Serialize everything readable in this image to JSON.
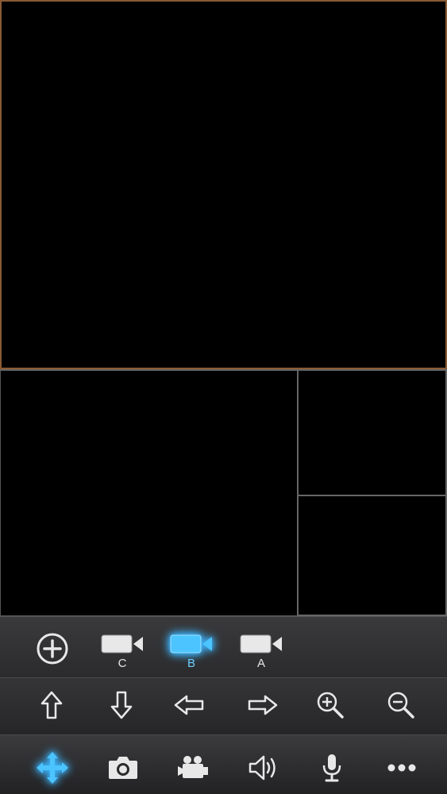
{
  "video_panes": [
    {
      "id": "main",
      "selected": true
    },
    {
      "id": "2",
      "selected": false
    },
    {
      "id": "3",
      "selected": false
    },
    {
      "id": "4",
      "selected": false
    }
  ],
  "stream_row": {
    "add_icon": "plus-circle-icon",
    "streams": [
      {
        "label": "C",
        "icon": "video-camera-icon",
        "active": false
      },
      {
        "label": "B",
        "icon": "video-camera-icon",
        "active": true
      },
      {
        "label": "A",
        "icon": "video-camera-icon",
        "active": false
      }
    ]
  },
  "ptz_row": {
    "buttons": [
      "arrow-up-icon",
      "arrow-down-icon",
      "arrow-left-icon",
      "arrow-right-icon",
      "zoom-in-icon",
      "zoom-out-icon"
    ]
  },
  "action_row": {
    "buttons": [
      "move-arrows-icon",
      "camera-snapshot-icon",
      "record-video-icon",
      "speaker-icon",
      "microphone-icon",
      "more-icon"
    ],
    "active": "move-arrows-icon"
  },
  "colors": {
    "selected_border": "#8a5a33",
    "active_accent": "#3cb6ff",
    "icon": "#e8e8e8"
  }
}
